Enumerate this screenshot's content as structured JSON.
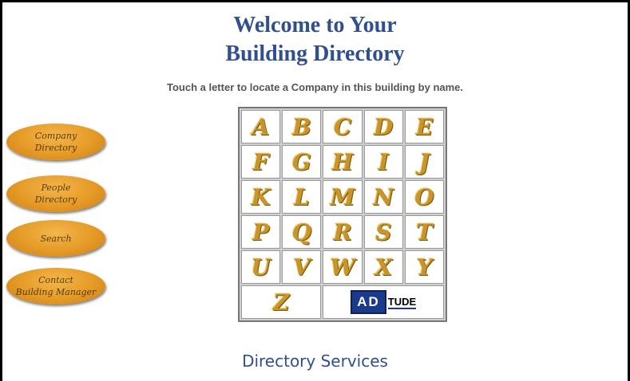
{
  "header": {
    "title_line1": "Welcome to Your",
    "title_line2": "Building Directory",
    "subtitle": "Touch a letter to locate a Company in this building by name."
  },
  "nav": {
    "company_directory": [
      "Company",
      "Directory"
    ],
    "people_directory": [
      "People",
      "Directory"
    ],
    "search": "Search",
    "contact_manager": [
      "Contact",
      "Building Manager"
    ]
  },
  "letters": {
    "A": "A",
    "B": "B",
    "C": "C",
    "D": "D",
    "E": "E",
    "F": "F",
    "G": "G",
    "H": "H",
    "I": "I",
    "J": "J",
    "K": "K",
    "L": "L",
    "M": "M",
    "N": "N",
    "O": "O",
    "P": "P",
    "Q": "Q",
    "R": "R",
    "S": "S",
    "T": "T",
    "U": "U",
    "V": "V",
    "W": "W",
    "X": "X",
    "Y": "Y",
    "Z": "Z"
  },
  "logo": {
    "part1": "AD",
    "part2": "TUDE"
  },
  "footer": {
    "text": "Directory Services"
  },
  "colors": {
    "title": "#2f4f8f",
    "button": "#e59a26",
    "letter": "#c8952a"
  }
}
